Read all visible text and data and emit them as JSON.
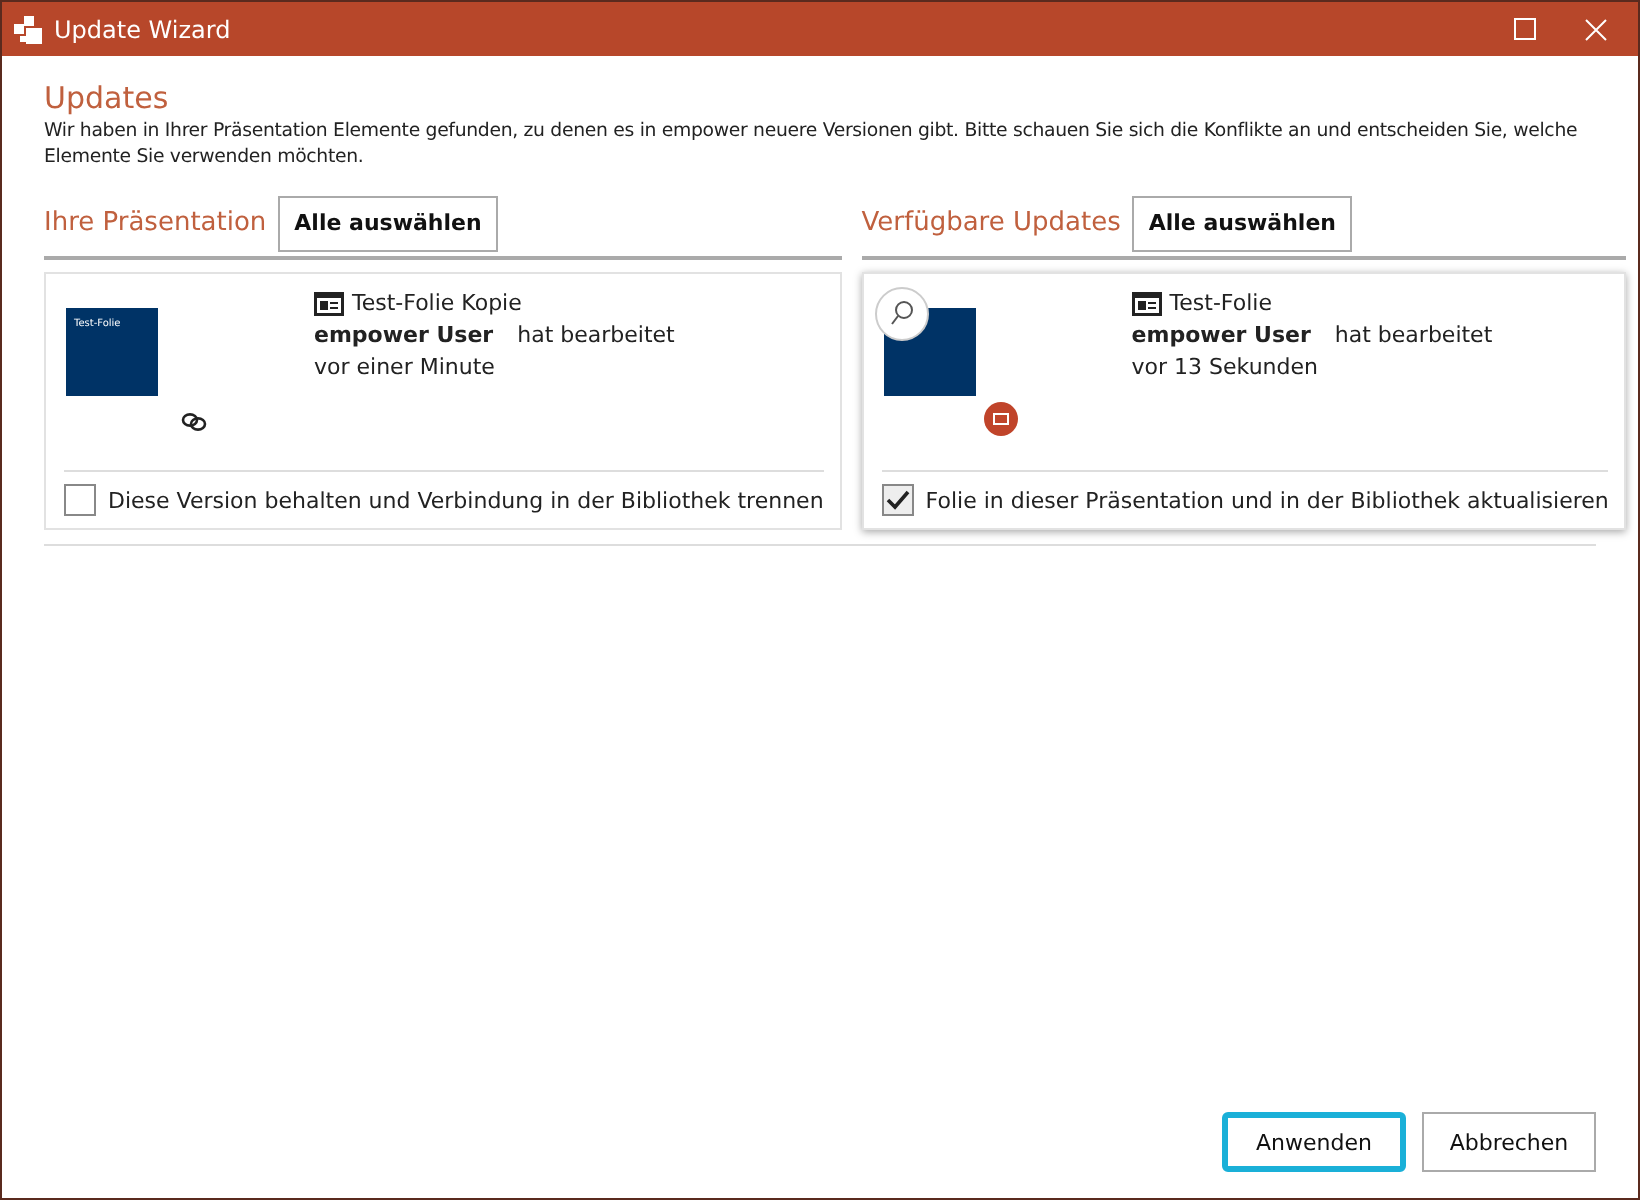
{
  "window": {
    "title": "Update Wizard"
  },
  "heading": "Updates",
  "intro": "Wir haben in Ihrer Präsentation Elemente gefunden, zu denen es in empower neuere Versionen gibt. Bitte schauen Sie sich die Konflikte an und entscheiden Sie, welche Elemente Sie verwenden möchten.",
  "columns": [
    {
      "title": "Ihre Präsentation",
      "select_all": "Alle auswählen",
      "cards": [
        {
          "kind": "linked",
          "selected": false,
          "thumbnail_title": "Test-Folie",
          "name": "Test-Folie Kopie",
          "user": "empower User",
          "action": "hat bearbeitet",
          "time": "vor einer Minute",
          "option": "Diese Version behalten und Verbindung in der Bibliothek trennen",
          "checked": false
        }
      ]
    },
    {
      "title": "Verfügbare Updates",
      "select_all": "Alle auswählen",
      "cards": [
        {
          "kind": "update",
          "selected": true,
          "name": "Test-Folie",
          "user": "empower User",
          "action": "hat bearbeitet",
          "time": "vor 13 Sekunden",
          "option": "Folie in dieser Präsentation und in der Bibliothek aktualisieren",
          "checked": true
        }
      ]
    }
  ],
  "buttons": [
    {
      "label": "Anwenden",
      "focused": true
    },
    {
      "label": "Abbrechen",
      "focused": false
    }
  ]
}
